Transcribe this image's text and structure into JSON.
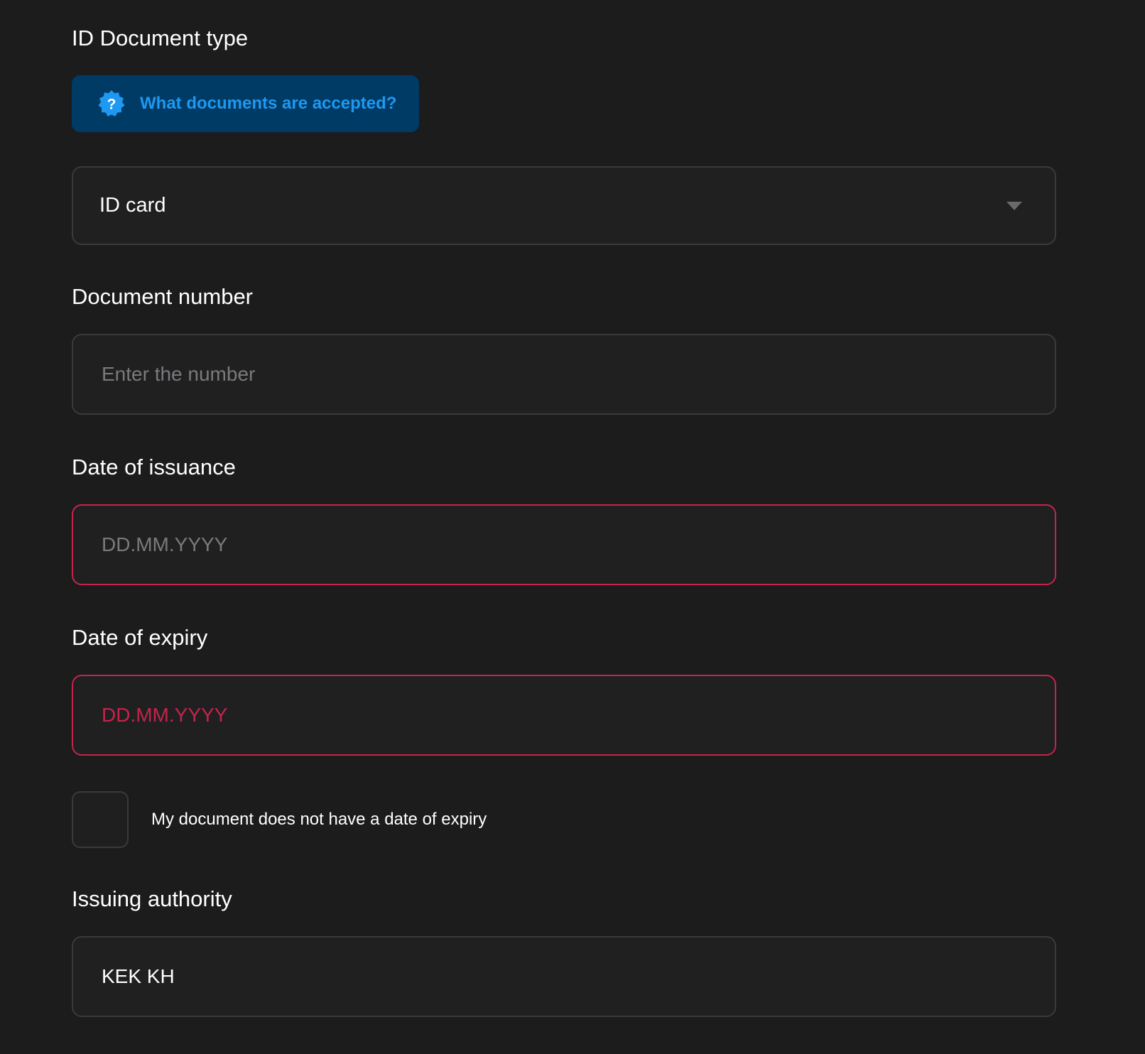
{
  "document_type": {
    "label": "ID Document type",
    "help_button": "What documents are accepted?",
    "help_icon": "question-badge-icon",
    "selected": "ID card",
    "caret_icon": "caret-down-icon"
  },
  "document_number": {
    "label": "Document number",
    "placeholder": "Enter the number"
  },
  "date_of_issuance": {
    "label": "Date of issuance",
    "placeholder": "DD.MM.YYYY",
    "state": "error"
  },
  "date_of_expiry": {
    "label": "Date of expiry",
    "placeholder": "DD.MM.YYYY",
    "state": "error"
  },
  "no_expiry": {
    "label": "My document does not have a date of expiry",
    "checked": false
  },
  "issuing_authority": {
    "label": "Issuing authority",
    "value": "KEK KH"
  },
  "colors": {
    "background": "#1c1c1d",
    "accent": "#1e98f0",
    "accent_bg": "#003b66",
    "error": "#c4244b",
    "border": "#3a3a3c"
  }
}
